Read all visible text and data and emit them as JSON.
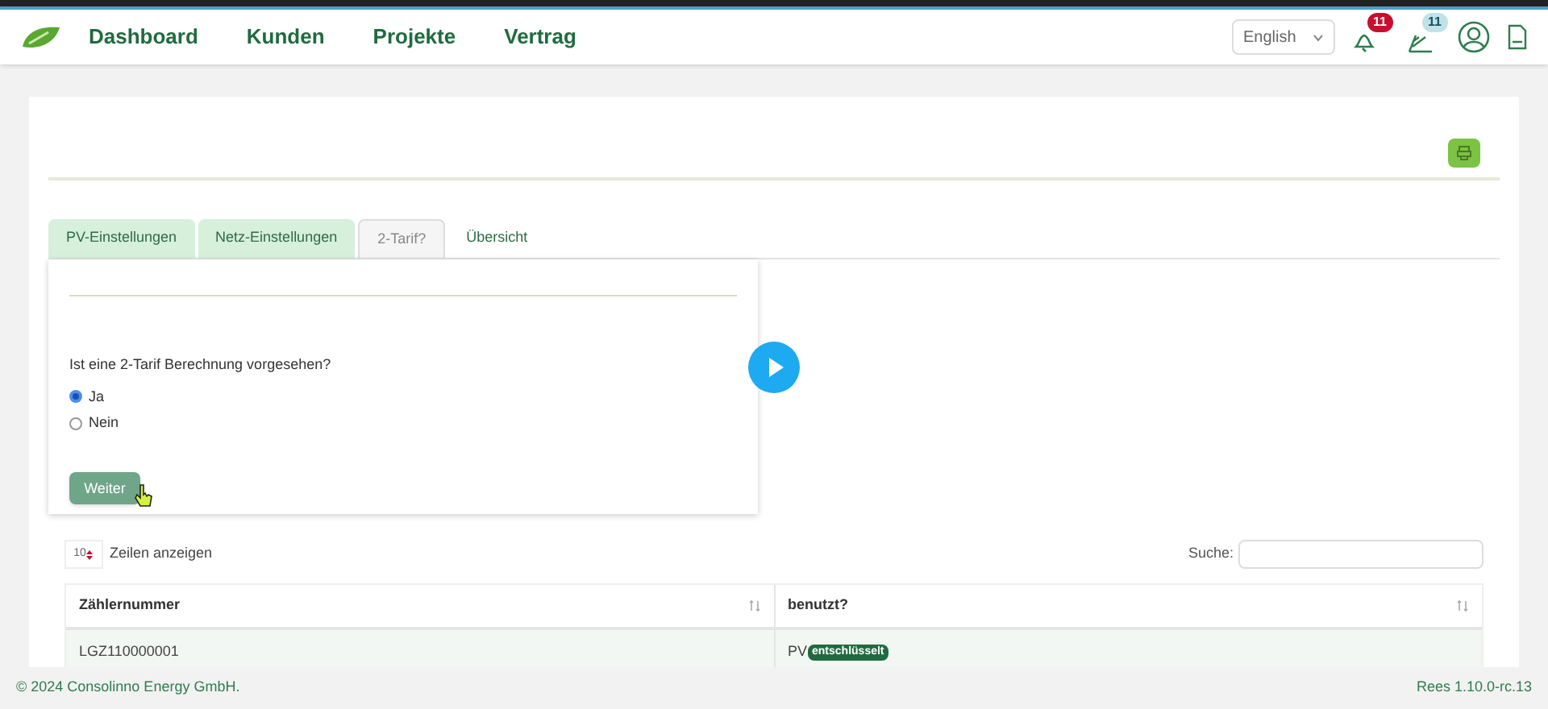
{
  "nav": {
    "items": [
      {
        "label": "Dashboard"
      },
      {
        "label": "Kunden"
      },
      {
        "label": "Projekte"
      },
      {
        "label": "Vertrag"
      }
    ],
    "language": "English",
    "notifications_count": "11",
    "tasks_count": "11"
  },
  "tabs": [
    {
      "label": "PV-Einstellungen",
      "selected": false,
      "done": true
    },
    {
      "label": "Netz-Einstellungen",
      "selected": false,
      "done": true
    },
    {
      "label": "2-Tarif?",
      "selected": true,
      "done": false
    },
    {
      "label": "Übersicht",
      "selected": false,
      "done": false
    }
  ],
  "form": {
    "question": "Ist eine 2-Tarif Berechnung vorgesehen?",
    "options": [
      {
        "label": "Ja",
        "selected": true
      },
      {
        "label": "Nein",
        "selected": false
      }
    ],
    "button": "Weiter"
  },
  "table": {
    "page_size": "10",
    "page_size_label": "Zeilen anzeigen",
    "search_label": "Suche:",
    "columns": [
      "Zählernummer",
      "benutzt?"
    ],
    "rows": [
      {
        "meter": "LGZ110000001",
        "used": "PV",
        "badge": "entschlüsselt"
      }
    ]
  },
  "footer": {
    "copyright": "© 2024 Consolinno Energy GmbH.",
    "version": "Rees 1.10.0-rc.13"
  }
}
